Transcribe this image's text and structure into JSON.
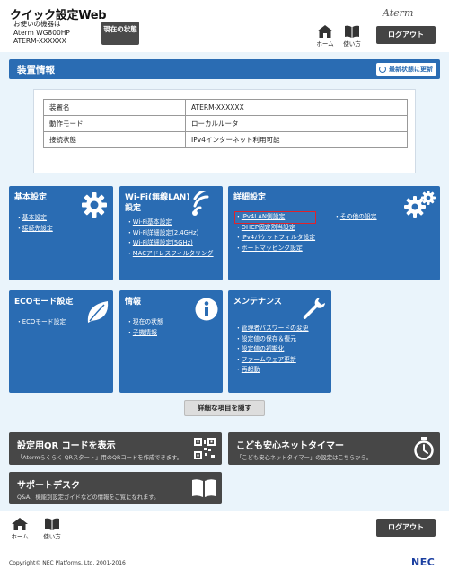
{
  "header": {
    "app_title": "クイック設定Web",
    "device_label": "お使いの機器は",
    "device_model": "Aterm WG800HP",
    "device_name": "ATERM-XXXXXX",
    "status_button": "現在の状態",
    "brand": "Aterm",
    "home_label": "ホーム",
    "help_label": "使い方",
    "logout_label": "ログアウト"
  },
  "page": {
    "title": "装置情報",
    "refresh_label": "最新状態に更新"
  },
  "info_table": [
    {
      "key": "装置名",
      "value": "ATERM-XXXXXX"
    },
    {
      "key": "動作モード",
      "value": "ローカルルータ"
    },
    {
      "key": "接続状態",
      "value": "IPv4インターネット利用可能"
    }
  ],
  "tiles": {
    "basic": {
      "title": "基本設定",
      "items": [
        "基本設定",
        "接続先設定"
      ]
    },
    "wifi": {
      "title": "Wi-Fi(無線LAN)設定",
      "items": [
        "Wi-Fi基本設定",
        "Wi-Fi詳細設定(2.4GHz)",
        "Wi-Fi詳細設定(5GHz)",
        "MACアドレスフィルタリング"
      ]
    },
    "detail": {
      "title": "詳細設定",
      "items_left": [
        "IPv4LAN側設定",
        "DHCP固定割当設定",
        "IPv4パケットフィルタ設定",
        "ポートマッピング設定"
      ],
      "items_right": [
        "その他の設定"
      ]
    },
    "eco": {
      "title": "ECOモード設定",
      "items": [
        "ECOモード設定"
      ]
    },
    "info": {
      "title": "情報",
      "items": [
        "現在の状態",
        "子機情報"
      ]
    },
    "maint": {
      "title": "メンテナンス",
      "items": [
        "管理者パスワードの変更",
        "設定値の保存＆復元",
        "設定値の初期化",
        "ファームウェア更新",
        "再起動"
      ]
    }
  },
  "hide_button": "詳細な項目を隠す",
  "banners": {
    "qr": {
      "title": "設定用QR コードを表示",
      "desc": "「Atermらくらく QRスタート」用のQRコードを作成できます。"
    },
    "timer": {
      "title": "こども安心ネットタイマー",
      "desc": "「こども安心ネットタイマー」の設定はこちらから。"
    },
    "support": {
      "title": "サポートデスク",
      "desc": "Q&A、機能別設定ガイドなどの情報をご覧になれます。"
    }
  },
  "footer": {
    "home_label": "ホーム",
    "help_label": "使い方",
    "logout_label": "ログアウト",
    "copyright": "Copyright© NEC Platforms, Ltd. 2001-2016",
    "logo": "NEC"
  },
  "colors": {
    "tile_blue": "#2a6cb3",
    "banner_gray": "#474747",
    "highlight_red": "#e0222b"
  }
}
